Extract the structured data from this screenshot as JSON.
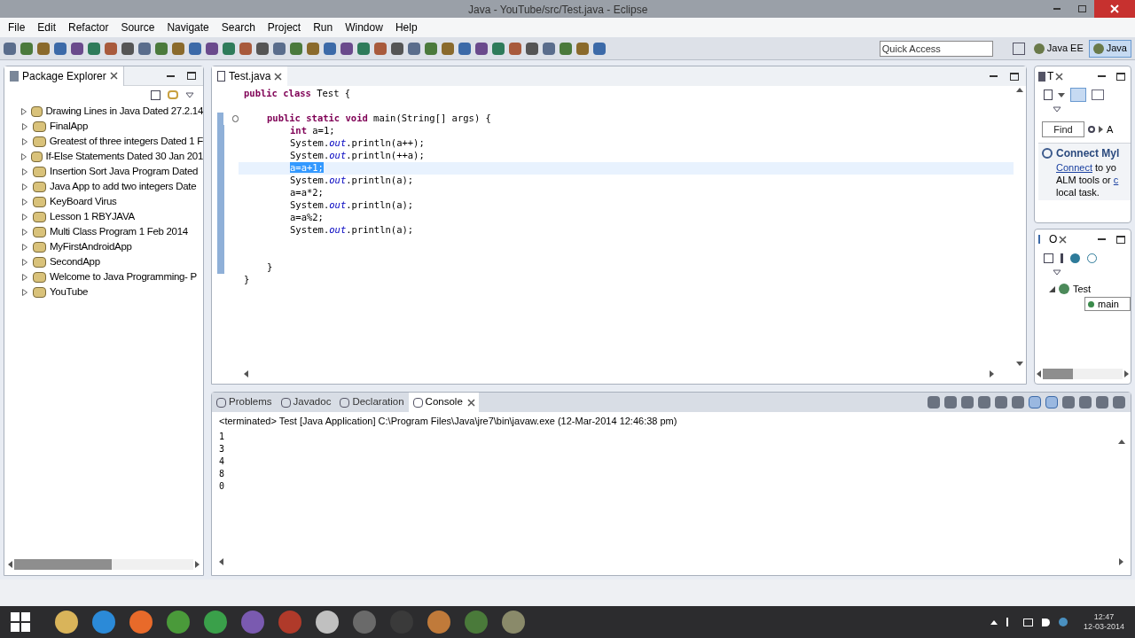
{
  "window": {
    "title": "Java - YouTube/src/Test.java - Eclipse"
  },
  "menu": [
    "File",
    "Edit",
    "Refactor",
    "Source",
    "Navigate",
    "Search",
    "Project",
    "Run",
    "Window",
    "Help"
  ],
  "quick_access": {
    "placeholder": "Quick Access"
  },
  "perspectives": [
    {
      "label": "Java EE",
      "selected": false
    },
    {
      "label": "Java",
      "selected": true
    }
  ],
  "package_explorer": {
    "title": "Package Explorer",
    "projects": [
      {
        "label": "Drawing Lines in Java Dated 27.2.14",
        "expanded": false
      },
      {
        "label": "FinalApp",
        "expanded": false
      },
      {
        "label": "Greatest of three integers Dated 1 F",
        "expanded": false
      },
      {
        "label": "If-Else Statements Dated 30 Jan 201",
        "expanded": false
      },
      {
        "label": "Insertion Sort Java Program Dated",
        "expanded": false
      },
      {
        "label": "Java App to add two integers Date",
        "expanded": false
      },
      {
        "label": "KeyBoard Virus",
        "expanded": false
      },
      {
        "label": "Lesson 1 RBYJAVA",
        "expanded": false
      },
      {
        "label": "Multi Class Program 1 Feb 2014",
        "expanded": false
      },
      {
        "label": "MyFirstAndroidApp",
        "expanded": false
      },
      {
        "label": "SecondApp",
        "expanded": false
      },
      {
        "label": "Welcome to Java Programming- P",
        "expanded": false
      },
      {
        "label": "YouTube",
        "expanded": false
      }
    ]
  },
  "editor": {
    "tab": "Test.java",
    "lines": [
      {
        "current": false,
        "tokens": [
          {
            "kind": "keyword",
            "text": "public class"
          },
          {
            "kind": "plain",
            "text": " Test {"
          }
        ],
        "children": [
          {
            "current": false
          },
          {
            "current": false,
            "tokens": [
              {
                "kind": "keyword",
                "text": "public static void"
              },
              {
                "kind": "plain",
                "text": " main(String[] args) {"
              }
            ],
            "children": [
              {
                "current": false,
                "tokens": [
                  {
                    "kind": "keyword",
                    "text": "int"
                  },
                  {
                    "kind": "plain",
                    "text": " a=1;"
                  }
                ]
              },
              {
                "current": false,
                "tokens": [
                  {
                    "kind": "plain",
                    "text": "System."
                  },
                  {
                    "kind": "field",
                    "text": "out"
                  },
                  {
                    "kind": "plain",
                    "text": ".println(a++);"
                  }
                ]
              },
              {
                "current": false,
                "tokens": [
                  {
                    "kind": "plain",
                    "text": "System."
                  },
                  {
                    "kind": "field",
                    "text": "out"
                  },
                  {
                    "kind": "plain",
                    "text": ".println(++a);"
                  }
                ]
              },
              {
                "current": true,
                "tokens": [
                  {
                    "kind": "selected",
                    "text": "a=a+1;"
                  }
                ]
              },
              {
                "current": false,
                "tokens": [
                  {
                    "kind": "plain",
                    "text": "System."
                  },
                  {
                    "kind": "field",
                    "text": "out"
                  },
                  {
                    "kind": "plain",
                    "text": ".println(a);"
                  }
                ]
              },
              {
                "current": false,
                "tokens": [
                  {
                    "kind": "plain",
                    "text": "a=a*2;"
                  }
                ]
              },
              {
                "current": false,
                "tokens": [
                  {
                    "kind": "plain",
                    "text": "System."
                  },
                  {
                    "kind": "field",
                    "text": "out"
                  },
                  {
                    "kind": "plain",
                    "text": ".println(a);"
                  }
                ]
              },
              {
                "current": false,
                "tokens": [
                  {
                    "kind": "plain",
                    "text": "a=a%2;"
                  }
                ]
              },
              {
                "current": false,
                "tokens": [
                  {
                    "kind": "plain",
                    "text": "System."
                  },
                  {
                    "kind": "field",
                    "text": "out"
                  },
                  {
                    "kind": "plain",
                    "text": ".println(a);"
                  }
                ]
              },
              {
                "current": false
              },
              {
                "current": false
              }
            ]
          },
          {
            "current": false,
            "tokens": [
              {
                "kind": "plain",
                "text": "}"
              }
            ]
          }
        ]
      },
      {
        "current": false,
        "tokens": [
          {
            "kind": "plain",
            "text": "}"
          }
        ]
      }
    ]
  },
  "task_list": {
    "tab": "T",
    "find": {
      "placeholder": "Find"
    },
    "filter": "A",
    "mylyn_title": "Connect Myl",
    "mylyn_link": "Connect",
    "mylyn_lines": [
      " to yo",
      "ALM tools or ",
      "local task."
    ],
    "mylyn_link2": "c"
  },
  "outline": {
    "tab": "O",
    "tree": [
      {
        "label": "Test",
        "expanded": true,
        "children": [
          {
            "label": "main",
            "selected": true
          }
        ]
      }
    ]
  },
  "bottom_tabs": [
    {
      "label": "Problems",
      "selected": false
    },
    {
      "label": "Javadoc",
      "selected": false
    },
    {
      "label": "Declaration",
      "selected": false
    },
    {
      "label": "Console",
      "selected": true
    }
  ],
  "console": {
    "header": "<terminated> Test [Java Application] C:\\Program Files\\Java\\jre7\\bin\\javaw.exe (12-Mar-2014 12:46:38 pm)",
    "output": [
      "1",
      "3",
      "4",
      "8",
      "0"
    ]
  },
  "taskbar": {
    "time": "12:47",
    "date": "12-03-2014"
  }
}
